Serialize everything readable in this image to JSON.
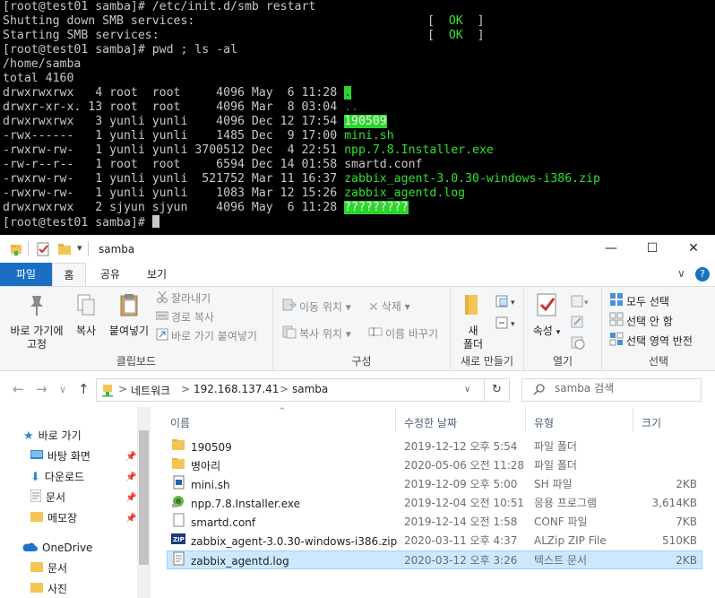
{
  "terminal": {
    "lines": {
      "l1": "[root@test01 samba]# /etc/init.d/smb restart",
      "l2": "Shutting down SMB services:",
      "l3": "Starting SMB services:",
      "l4": "[root@test01 samba]# pwd ; ls -al",
      "l5": "/home/samba",
      "l6": "total 4160",
      "l16": "[root@test01 samba]# "
    },
    "ok_open": "[  ",
    "ok_text": "OK",
    "ok_close": "  ]",
    "listing": [
      {
        "perm": "drwxrwxrwx   4 root  root     4096 May  6 11:28 ",
        "name": "."
      },
      {
        "perm": "drwxr-xr-x. 13 root  root     4096 Mar  8 03:04 ",
        "name": ".."
      },
      {
        "perm": "drwxrwxrwx   3 yunli yunli    4096 Dec 12 17:54 ",
        "name": "190509"
      },
      {
        "perm": "-rwx------   1 yunli yunli    1485 Dec  9 17:00 ",
        "name": "mini.sh"
      },
      {
        "perm": "-rwxrw-rw-   1 yunli yunli 3700512 Dec  4 22:51 ",
        "name": "npp.7.8.Installer.exe"
      },
      {
        "perm": "-rw-r--r--   1 root  root     6594 Dec 14 01:58 ",
        "name": "smartd.conf"
      },
      {
        "perm": "-rwxrw-rw-   1 yunli yunli  521752 Mar 11 16:37 ",
        "name": "zabbix_agent-3.0.30-windows-i386.zip"
      },
      {
        "perm": "-rwxrw-rw-   1 yunli yunli    1083 Mar 12 15:26 ",
        "name": "zabbix_agentd.log"
      },
      {
        "perm": "drwxrwxrwx   2 sjyun sjyun    4096 May  6 11:28 ",
        "name": "?????????"
      }
    ]
  },
  "window": {
    "title": "samba",
    "minimize": "—",
    "maximize": "☐",
    "close": "✕",
    "qat_dropdown": "▾"
  },
  "tabs": {
    "file": "파일",
    "home": "홈",
    "share": "공유",
    "view": "보기",
    "collapse": "∨",
    "help": "?"
  },
  "ribbon": {
    "clipboard": {
      "pin": "바로 가기에\n고정",
      "copy": "복사",
      "paste": "붙여넣기",
      "cut": "잘라내기",
      "copy_path": "경로 복사",
      "paste_shortcut": "바로 가기 붙여넣기",
      "label": "클립보드"
    },
    "organize": {
      "move_to": "이동 위치",
      "copy_to": "복사 위치",
      "delete": "삭제",
      "rename": "이름 바꾸기",
      "label": "구성"
    },
    "new": {
      "new_folder": "새\n폴더",
      "label": "새로 만들기"
    },
    "open": {
      "properties": "속성",
      "label": "열기"
    },
    "select": {
      "select_all": "모두 선택",
      "select_none": "선택 안 함",
      "invert": "선택 영역 반전",
      "label": "선택"
    }
  },
  "address": {
    "back": "←",
    "forward": "→",
    "recent": "∨",
    "up": "↑",
    "crumbs": [
      "네트워크",
      "192.168.137.41",
      "samba"
    ],
    "sep": ">",
    "dropdown": "∨",
    "refresh": "↻",
    "search_placeholder": "samba 검색"
  },
  "nav": {
    "quick_access": "바로 가기",
    "desktop": "바탕 화면",
    "downloads": "다운로드",
    "documents": "문서",
    "notepad": "메모장",
    "onedrive": "OneDrive",
    "od_documents": "문서",
    "od_pictures": "사진"
  },
  "columns": {
    "name": "이름",
    "date": "수정한 날짜",
    "type": "유형",
    "size": "크기",
    "sort": "^"
  },
  "files": [
    {
      "icon": "folder-icon",
      "name": "190509",
      "date": "2019-12-12 오후 5:54",
      "type": "파일 폴더",
      "size": ""
    },
    {
      "icon": "folder-icon",
      "name": "병아리",
      "date": "2020-05-06 오전 11:28",
      "type": "파일 폴더",
      "size": ""
    },
    {
      "icon": "sh-file-icon",
      "name": "mini.sh",
      "date": "2019-12-09 오후 5:00",
      "type": "SH 파일",
      "size": "2KB"
    },
    {
      "icon": "installer-icon",
      "name": "npp.7.8.Installer.exe",
      "date": "2019-12-04 오전 10:51",
      "type": "응용 프로그램",
      "size": "3,614KB"
    },
    {
      "icon": "conf-file-icon",
      "name": "smartd.conf",
      "date": "2019-12-14 오전 1:58",
      "type": "CONF 파일",
      "size": "7KB"
    },
    {
      "icon": "zip-icon",
      "name": "zabbix_agent-3.0.30-windows-i386.zip",
      "date": "2020-03-11 오후 4:37",
      "type": "ALZip ZIP File",
      "size": "510KB"
    },
    {
      "icon": "log-file-icon",
      "name": "zabbix_agentd.log",
      "date": "2020-03-12 오후 3:26",
      "type": "텍스트 문서",
      "size": "2KB"
    }
  ]
}
